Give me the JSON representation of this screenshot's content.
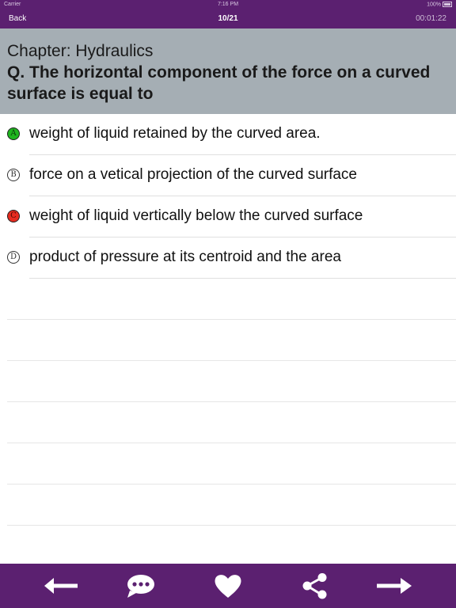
{
  "status_bar": {
    "carrier": "Carrier",
    "time": "7:16 PM",
    "battery": "100%"
  },
  "nav": {
    "back_label": "Back",
    "progress": "10/21",
    "timer": "00:01:22"
  },
  "question": {
    "chapter": "Chapter: Hydraulics",
    "text": "Q. The horizontal component of the force on a curved surface is equal to"
  },
  "options": [
    {
      "letter": "A",
      "text": "weight of liquid retained by the curved area.",
      "state": "correct"
    },
    {
      "letter": "B",
      "text": "force on a vetical projection of the curved surface",
      "state": "normal"
    },
    {
      "letter": "C",
      "text": "weight of liquid vertically below the curved surface",
      "state": "wrong"
    },
    {
      "letter": "D",
      "text": "product of pressure at its centroid and the area",
      "state": "normal"
    }
  ],
  "colors": {
    "bar": "#5b2070",
    "question_bg": "#a5aeb4",
    "correct": "#1fb51f",
    "wrong": "#e52b1f"
  },
  "toolbar": {
    "icons": [
      "arrow-left-icon",
      "comment-icon",
      "heart-icon",
      "share-icon",
      "arrow-right-icon"
    ]
  }
}
